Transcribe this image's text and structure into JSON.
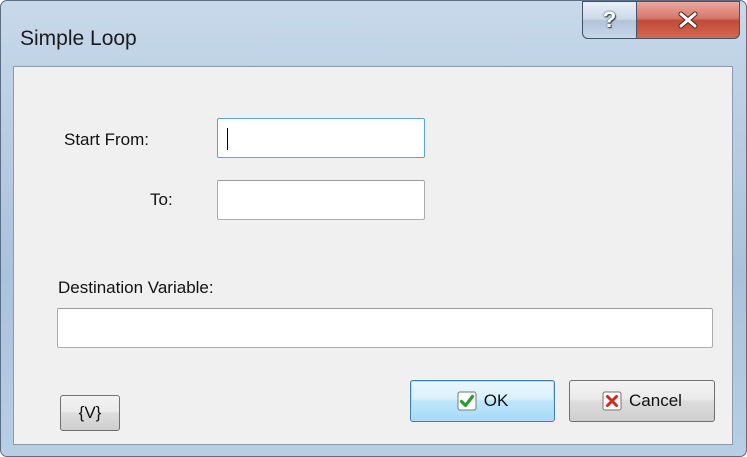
{
  "window": {
    "title": "Simple Loop",
    "help_glyph": "?",
    "close_icon": "close-x-icon",
    "help_icon": "question-mark-icon"
  },
  "form": {
    "start_from_label": "Start From:",
    "start_from_value": "",
    "to_label": "To:",
    "to_value": "",
    "destination_label": "Destination Variable:",
    "destination_value": ""
  },
  "buttons": {
    "variables_label": "{V}",
    "ok_label": "OK",
    "ok_icon": "checkmark-icon",
    "cancel_label": "Cancel",
    "cancel_icon": "cross-icon"
  },
  "colors": {
    "check_green": "#2e9a2e",
    "cross_red": "#d4281c",
    "focus_border": "#5ea3d6"
  }
}
